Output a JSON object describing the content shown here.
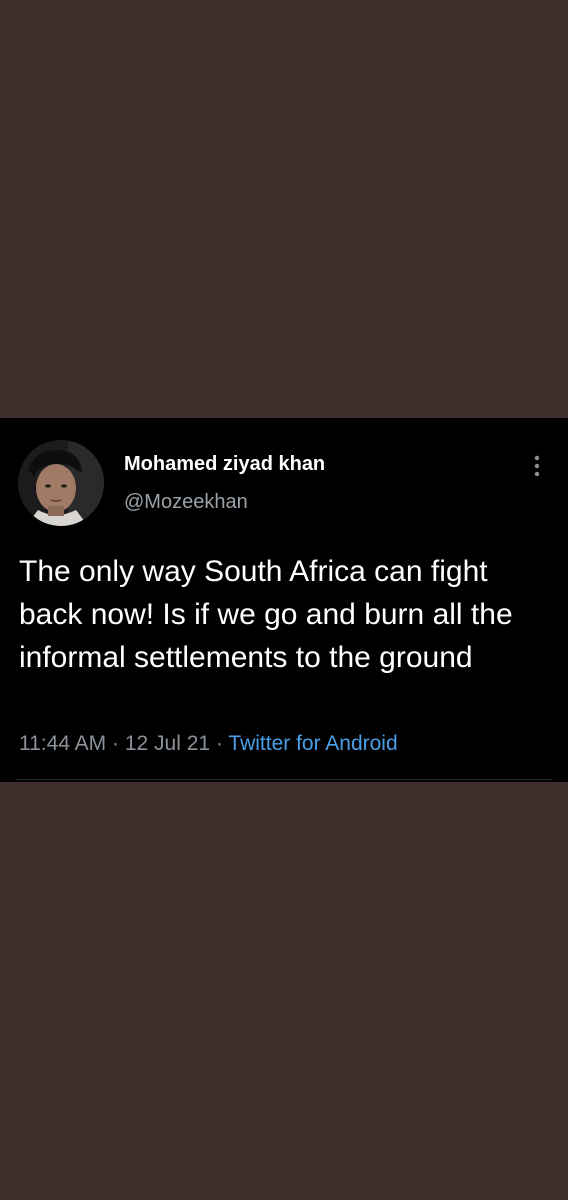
{
  "tweet": {
    "author_name": "Mohamed ziyad khan",
    "author_handle": "@Mozeekhan",
    "text": "The only way South Africa can fight back now! Is if we go and burn all the informal settlements to the ground",
    "time": "11:44 AM",
    "separator": "·",
    "date": "12 Jul 21",
    "source": "Twitter for Android"
  },
  "icons": {
    "menu": "more-vertical-icon"
  },
  "colors": {
    "page_background": "#3d2f2c",
    "card_background": "#000000",
    "link": "#4a9fe8",
    "muted_text": "#8b9299"
  }
}
